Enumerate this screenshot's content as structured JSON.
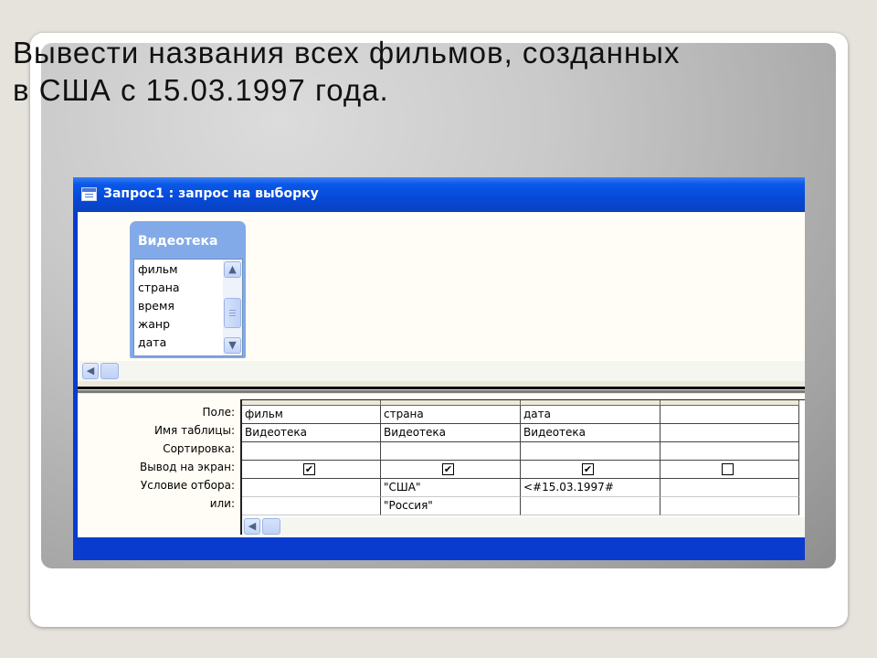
{
  "slide": {
    "title": "Вывести названия всех фильмов, созданных\n   в США с 15.03.1997 года."
  },
  "window": {
    "title": "Запрос1 : запрос на выборку",
    "title_icon": "query-icon",
    "accent_color": "#0a3bcf"
  },
  "table_box": {
    "title": "Видеотека",
    "fields": [
      "фильм",
      "страна",
      "время",
      "жанр",
      "дата"
    ]
  },
  "grid": {
    "row_labels": [
      "Поле:",
      "Имя таблицы:",
      "Сортировка:",
      "Вывод на экран:",
      "Условие отбора:",
      "или:"
    ],
    "columns": [
      {
        "field": "фильм",
        "table": "Видеотека",
        "sort": "",
        "show": true,
        "criteria": "",
        "or": ""
      },
      {
        "field": "страна",
        "table": "Видеотека",
        "sort": "",
        "show": true,
        "criteria": "\"США\"",
        "or": "\"Россия\""
      },
      {
        "field": "дата",
        "table": "Видеотека",
        "sort": "",
        "show": true,
        "criteria": "<#15.03.1997#",
        "or": ""
      },
      {
        "field": "",
        "table": "",
        "sort": "",
        "show": false,
        "criteria": "",
        "or": ""
      }
    ]
  },
  "icons": {
    "scroll_up": "chevron-up-icon",
    "scroll_down": "chevron-down-icon",
    "scroll_left": "chevron-left-icon"
  }
}
